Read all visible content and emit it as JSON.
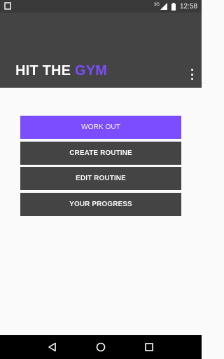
{
  "status_bar": {
    "network": "3G",
    "time": "12:58",
    "notification_icon": "notification-square-icon",
    "signal_icon": "signal-icon",
    "battery_icon": "battery-icon"
  },
  "app_bar": {
    "title_part1": "HIT THE ",
    "title_part2": "GYM",
    "overflow_icon": "more-vertical-icon"
  },
  "menu": {
    "items": [
      {
        "label": "WORK OUT"
      },
      {
        "label": "CREATE ROUTINE"
      },
      {
        "label": "EDIT ROUTINE"
      },
      {
        "label": "YOUR PROGRESS"
      }
    ]
  },
  "nav_bar": {
    "back_icon": "back-icon",
    "home_icon": "home-icon",
    "recents_icon": "recents-icon"
  },
  "colors": {
    "accent": "#7c4dff",
    "button": "#444444",
    "app_bar": "#444444",
    "background": "#fafafa"
  }
}
